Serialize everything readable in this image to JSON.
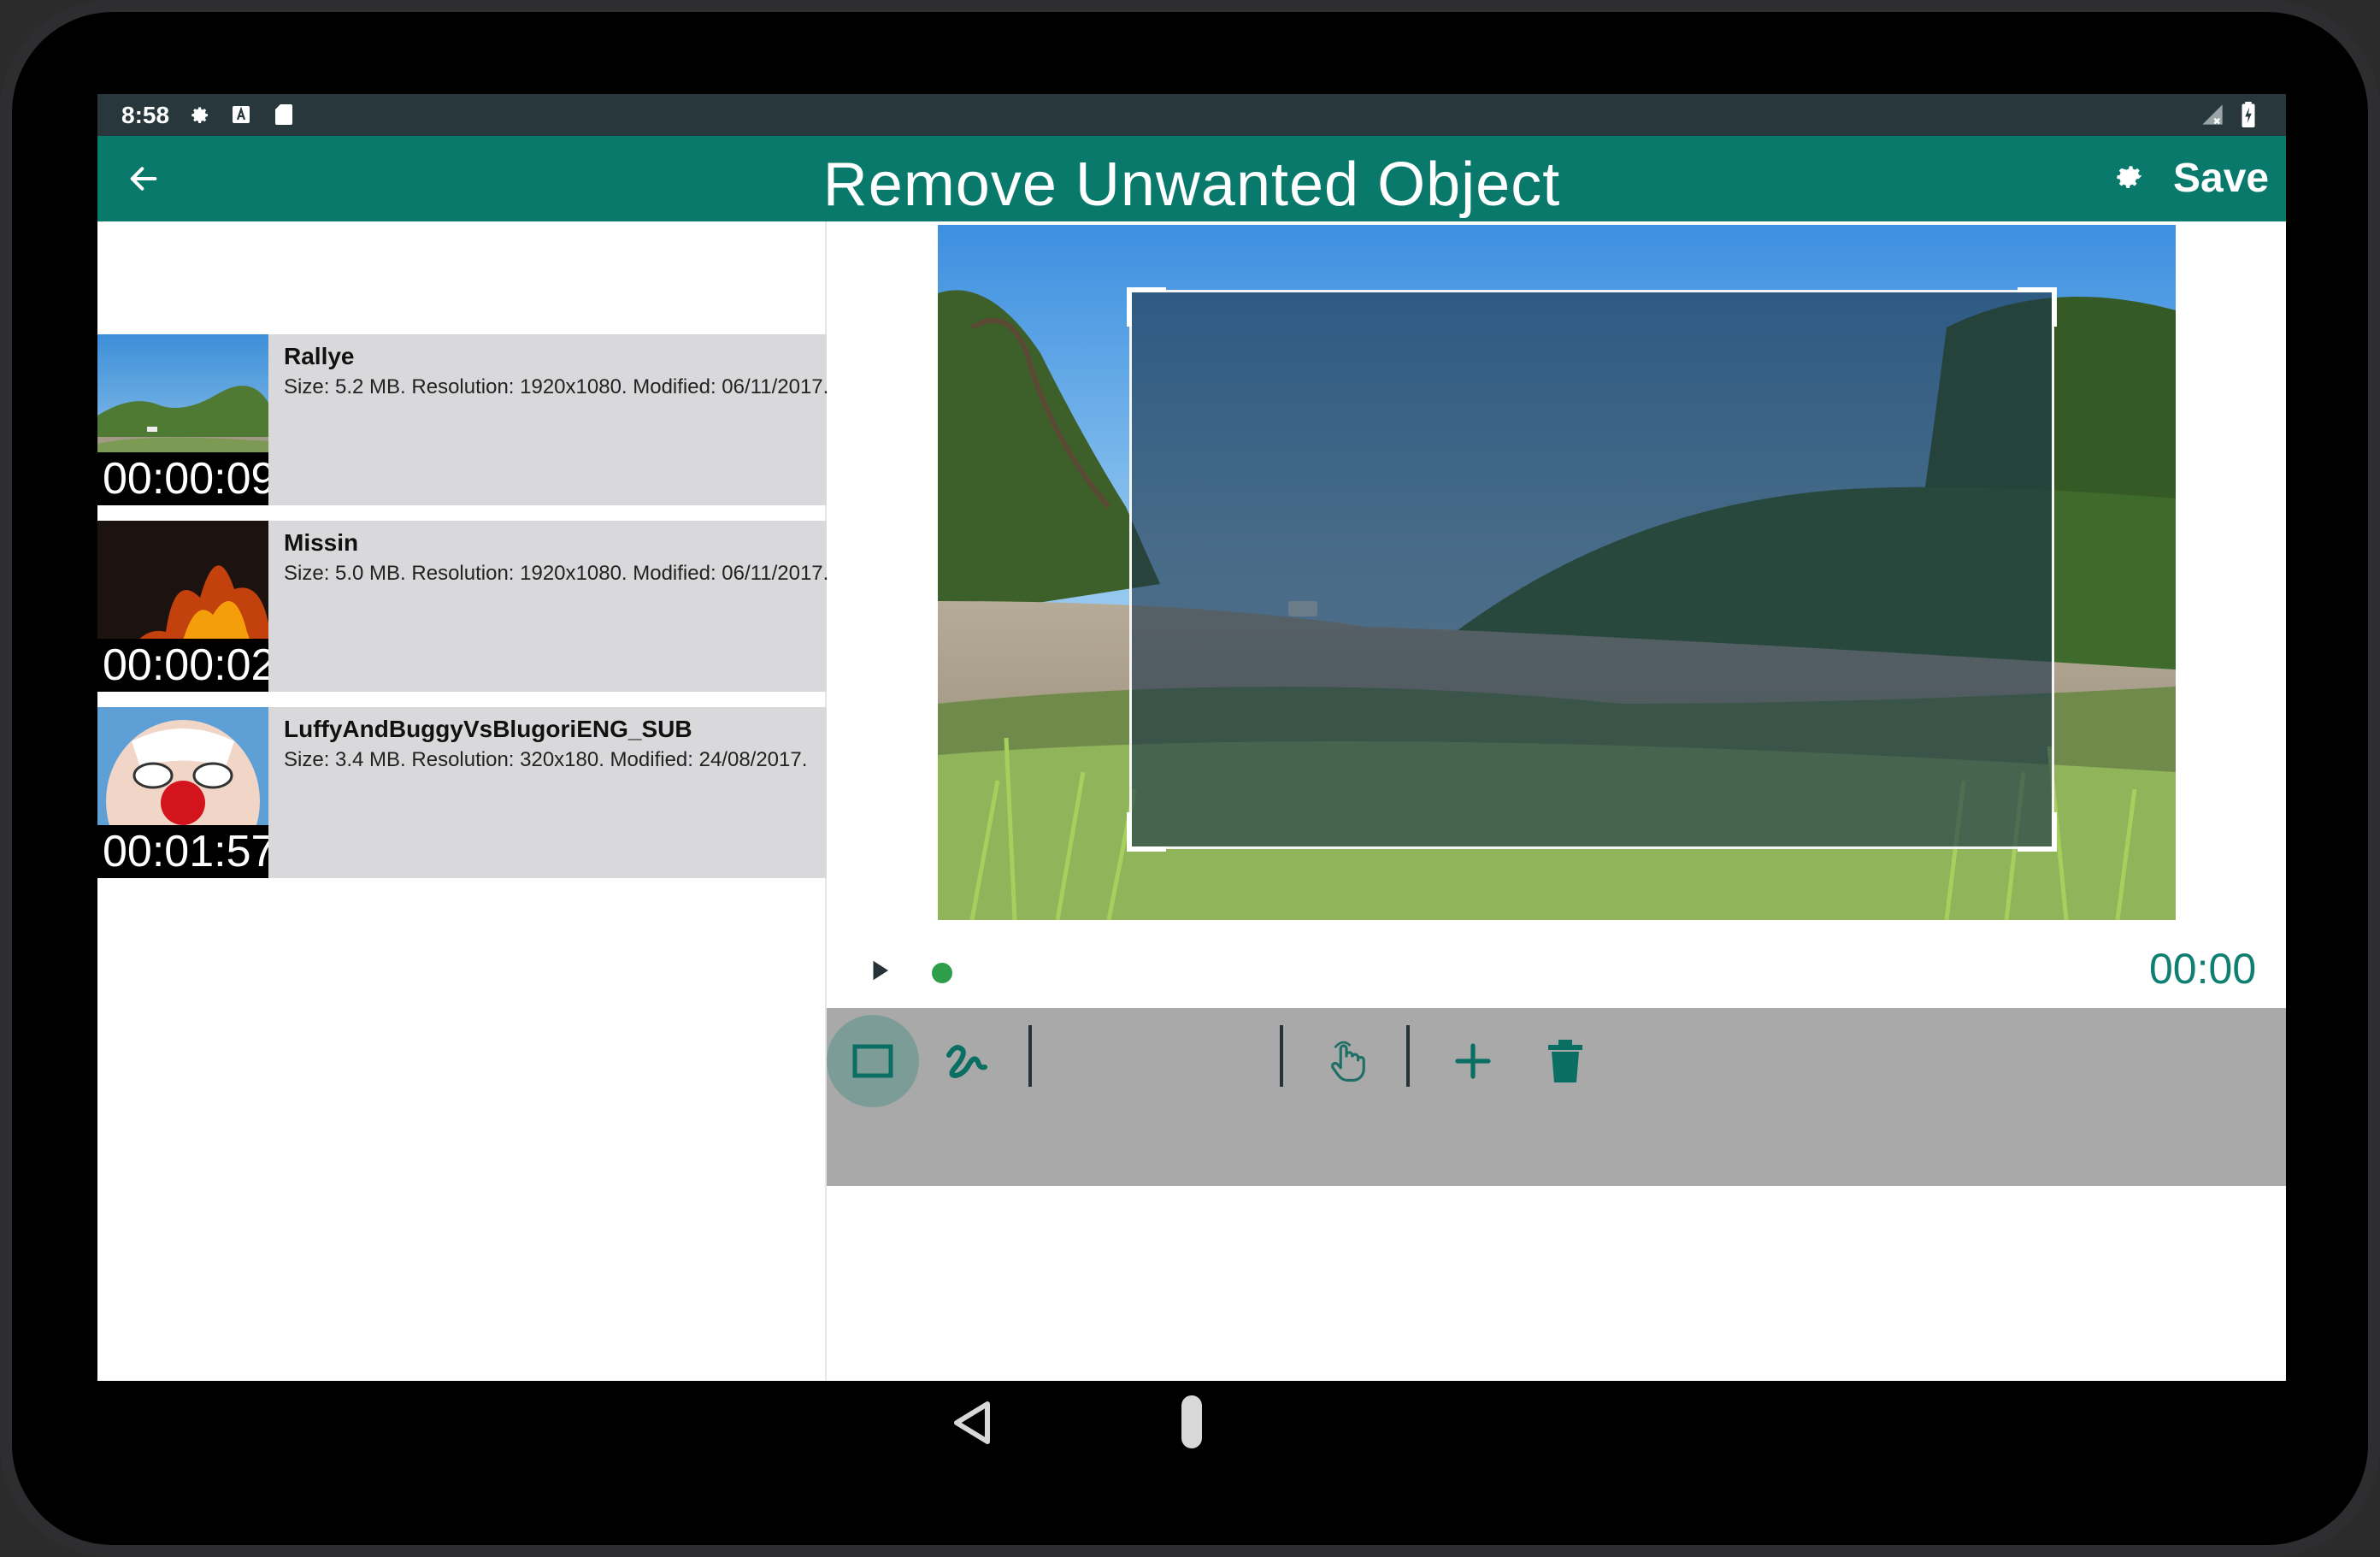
{
  "status_bar": {
    "time": "8:58"
  },
  "app_bar": {
    "title": "Remove Unwanted Object",
    "save_label": "Save"
  },
  "videos": [
    {
      "name": "Rallye",
      "meta": "Size: 5.2 MB. Resolution: 1920x1080. Modified: 06/11/2017.",
      "duration": "00:00:09"
    },
    {
      "name": "Missin",
      "meta": "Size: 5.0 MB. Resolution: 1920x1080. Modified: 06/11/2017.",
      "duration": "00:00:02"
    },
    {
      "name": "LuffyAndBuggyVsBlugoriENG_SUB",
      "meta": "Size: 3.4 MB. Resolution: 320x180. Modified: 24/08/2017.",
      "duration": "00:01:57"
    }
  ],
  "player": {
    "timecode": "00:00"
  },
  "tools": [
    "rectangle-select",
    "freehand-select",
    "hand-tool",
    "add",
    "delete"
  ],
  "colors": {
    "primary": "#08796a",
    "status_bar": "#27373b",
    "accent": "#2e9e4b",
    "list_row": "#d9d9db",
    "tools_bar": "#a9a9a9"
  }
}
